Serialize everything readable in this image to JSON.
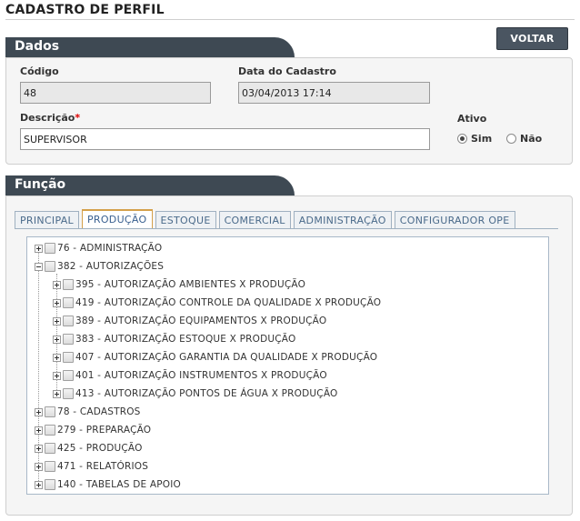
{
  "page": {
    "title": "CADASTRO DE PERFIL",
    "back_label": "VOLTAR"
  },
  "dados": {
    "section_title": "Dados",
    "codigo_label": "Código",
    "codigo_value": "48",
    "data_label": "Data do Cadastro",
    "data_value": "03/04/2013 17:14",
    "descricao_label": "Descrição",
    "descricao_required": "*",
    "descricao_value": "SUPERVISOR",
    "ativo_label": "Ativo",
    "ativo_options": [
      {
        "label": "Sim",
        "selected": true
      },
      {
        "label": "Não",
        "selected": false
      }
    ]
  },
  "funcao": {
    "section_title": "Função",
    "tabs": [
      {
        "label": "PRINCIPAL",
        "active": false
      },
      {
        "label": "PRODUÇÃO",
        "active": true
      },
      {
        "label": "ESTOQUE",
        "active": false
      },
      {
        "label": "COMERCIAL",
        "active": false
      },
      {
        "label": "ADMINISTRAÇÃO",
        "active": false
      },
      {
        "label": "CONFIGURADOR OPE",
        "active": false
      }
    ],
    "tree": [
      {
        "label": "76 - ADMINISTRAÇÃO",
        "level": 0,
        "expanded": false
      },
      {
        "label": "382 - AUTORIZAÇÕES",
        "level": 0,
        "expanded": true
      },
      {
        "label": "395 - AUTORIZAÇÃO AMBIENTES X PRODUÇÃO",
        "level": 1,
        "expanded": false
      },
      {
        "label": "419 - AUTORIZAÇÃO CONTROLE DA QUALIDADE X PRODUÇÃO",
        "level": 1,
        "expanded": false
      },
      {
        "label": "389 - AUTORIZAÇÃO EQUIPAMENTOS X PRODUÇÃO",
        "level": 1,
        "expanded": false
      },
      {
        "label": "383 - AUTORIZAÇÃO ESTOQUE X PRODUÇÃO",
        "level": 1,
        "expanded": false
      },
      {
        "label": "407 - AUTORIZAÇÃO GARANTIA DA QUALIDADE X PRODUÇÃO",
        "level": 1,
        "expanded": false
      },
      {
        "label": "401 - AUTORIZAÇÃO INSTRUMENTOS X PRODUÇÃO",
        "level": 1,
        "expanded": false
      },
      {
        "label": "413 - AUTORIZAÇÃO PONTOS DE ÁGUA X PRODUÇÃO",
        "level": 1,
        "expanded": false
      },
      {
        "label": "78 - CADASTROS",
        "level": 0,
        "expanded": false
      },
      {
        "label": "279 - PREPARAÇÃO",
        "level": 0,
        "expanded": false
      },
      {
        "label": "425 - PRODUÇÃO",
        "level": 0,
        "expanded": false
      },
      {
        "label": "471 - RELATÓRIOS",
        "level": 0,
        "expanded": false
      },
      {
        "label": "140 - TABELAS DE APOIO",
        "level": 0,
        "expanded": false
      }
    ]
  }
}
